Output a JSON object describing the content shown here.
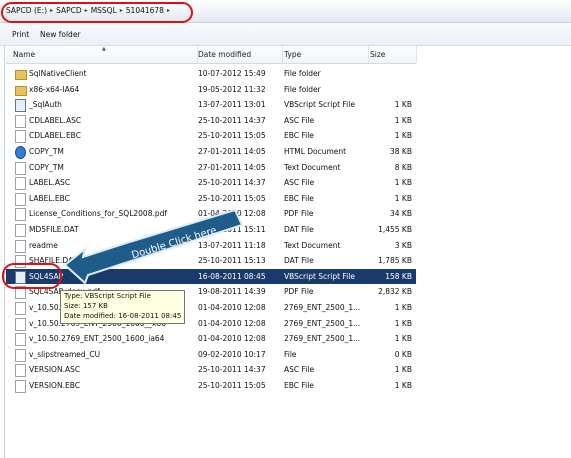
{
  "address_bar": {
    "crumbs": [
      "SAPCD (E:)",
      "SAPCD",
      "MSSQL",
      "51041678"
    ]
  },
  "toolbar": {
    "print": "Print",
    "new_folder": "New folder"
  },
  "columns": {
    "name": "Name",
    "date": "Date modified",
    "type": "Type",
    "size": "Size"
  },
  "files": [
    {
      "name": "SqlNativeClient",
      "date": "10-07-2012 15:49",
      "type": "File folder",
      "size": "",
      "icon": "folder-icon"
    },
    {
      "name": "x86-x64-IA64",
      "date": "19-05-2012 11:32",
      "type": "File folder",
      "size": "",
      "icon": "folder-icon"
    },
    {
      "name": "_SqlAuth",
      "date": "13-07-2011 13:01",
      "type": "VBScript Script File",
      "size": "1 KB",
      "icon": "script-icon"
    },
    {
      "name": "CDLABEL.ASC",
      "date": "25-10-2011 14:37",
      "type": "ASC File",
      "size": "1 KB",
      "icon": "file-icon"
    },
    {
      "name": "CDLABEL.EBC",
      "date": "25-10-2011 15:05",
      "type": "EBC File",
      "size": "1 KB",
      "icon": "file-icon"
    },
    {
      "name": "COPY_TM",
      "date": "27-01-2011 14:05",
      "type": "HTML Document",
      "size": "38 KB",
      "icon": "html-icon"
    },
    {
      "name": "COPY_TM",
      "date": "27-01-2011 14:05",
      "type": "Text Document",
      "size": "8 KB",
      "icon": "file-icon"
    },
    {
      "name": "LABEL.ASC",
      "date": "25-10-2011 14:37",
      "type": "ASC File",
      "size": "1 KB",
      "icon": "file-icon"
    },
    {
      "name": "LABEL.EBC",
      "date": "25-10-2011 15:05",
      "type": "EBC File",
      "size": "1 KB",
      "icon": "file-icon"
    },
    {
      "name": "License_Conditions_for_SQL2008.pdf",
      "date": "01-04-2010 12:08",
      "type": "PDF File",
      "size": "34 KB",
      "icon": "file-icon"
    },
    {
      "name": "MD5FILE.DAT",
      "date": "25-10-2011 15:11",
      "type": "DAT File",
      "size": "1,455 KB",
      "icon": "file-icon"
    },
    {
      "name": "readme",
      "date": "13-07-2011 11:18",
      "type": "Text Document",
      "size": "3 KB",
      "icon": "file-icon"
    },
    {
      "name": "SHAFILE.DAT",
      "date": "25-10-2011 15:13",
      "type": "DAT File",
      "size": "1,785 KB",
      "icon": "file-icon"
    },
    {
      "name": "SQL4SAP",
      "date": "16-08-2011 08:45",
      "type": "VBScript Script File",
      "size": "158 KB",
      "icon": "script-icon",
      "selected": true
    },
    {
      "name": "SQL4SAP_docu.pdf",
      "date": "19-08-2011 14:39",
      "type": "PDF File",
      "size": "2,832 KB",
      "icon": "file-icon"
    },
    {
      "name": "v_10.50.2769_ENT_2500_1600",
      "date": "01-04-2010 12:08",
      "type": "2769_ENT_2500_1...",
      "size": "1 KB",
      "icon": "file-icon"
    },
    {
      "name": "v_10.50.2769_ENT_2500_1600__x86",
      "date": "01-04-2010 12:08",
      "type": "2769_ENT_2500_1...",
      "size": "1 KB",
      "icon": "file-icon"
    },
    {
      "name": "v_10.50.2769_ENT_2500_1600_ia64",
      "date": "01-04-2010 12:08",
      "type": "2769_ENT_2500_1...",
      "size": "1 KB",
      "icon": "file-icon"
    },
    {
      "name": "v_slipstreamed_CU",
      "date": "09-02-2010 10:17",
      "type": "File",
      "size": "0 KB",
      "icon": "file-icon"
    },
    {
      "name": "VERSION.ASC",
      "date": "25-10-2011 14:37",
      "type": "ASC File",
      "size": "1 KB",
      "icon": "file-icon"
    },
    {
      "name": "VERSION.EBC",
      "date": "25-10-2011 15:05",
      "type": "EBC File",
      "size": "1 KB",
      "icon": "file-icon"
    }
  ],
  "callout": {
    "text": "Double Click here"
  },
  "tooltip": {
    "type": "Type: VBScript Script File",
    "size": "Size: 157 KB",
    "date": "Date modified: 16-08-2011 08:45"
  }
}
